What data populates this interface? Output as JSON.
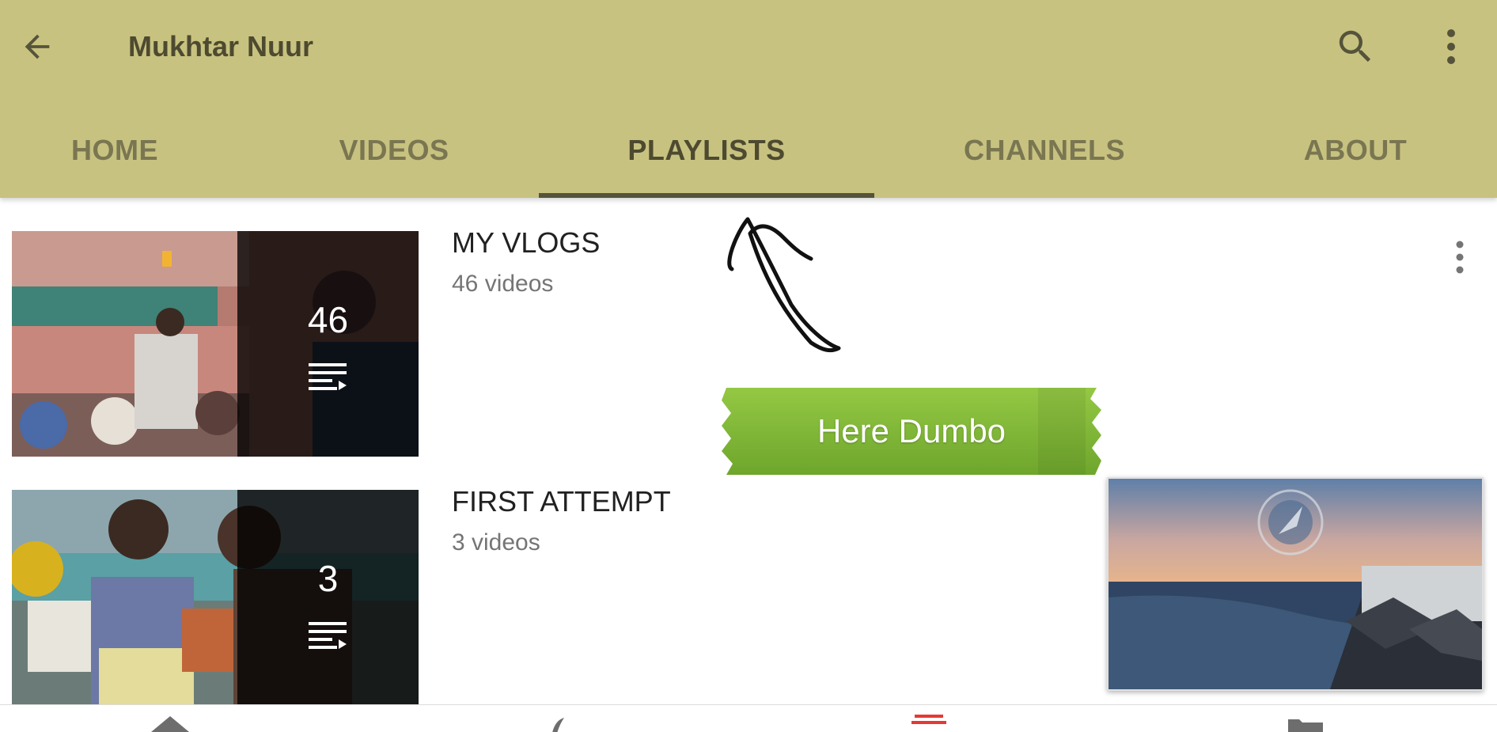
{
  "header": {
    "title": "Mukhtar Nuur",
    "back_icon": "arrow-left-icon",
    "search_icon": "search-icon",
    "more_icon": "more-vert-icon",
    "background": "#c8c280"
  },
  "tabs": [
    {
      "label": "HOME",
      "active": false
    },
    {
      "label": "VIDEOS",
      "active": false
    },
    {
      "label": "PLAYLISTS",
      "active": true
    },
    {
      "label": "CHANNELS",
      "active": false
    },
    {
      "label": "ABOUT",
      "active": false
    }
  ],
  "playlists": [
    {
      "title": "MY VLOGS",
      "subtitle": "46 videos",
      "count": "46",
      "icon": "playlist-icon"
    },
    {
      "title": "FIRST ATTEMPT",
      "subtitle": "3 videos",
      "count": "3",
      "icon": "playlist-icon"
    }
  ],
  "annotation": {
    "label": "Here Dumbo",
    "color": "#7db432"
  },
  "mini_player": {
    "icon": "channel-logo-watermark"
  },
  "bottom_nav": {
    "items": [
      {
        "icon": "home-icon"
      },
      {
        "icon": "trending-icon"
      },
      {
        "icon": "subscriptions-icon",
        "active": true
      },
      {
        "icon": "library-icon"
      }
    ],
    "active_color": "#e53935"
  }
}
